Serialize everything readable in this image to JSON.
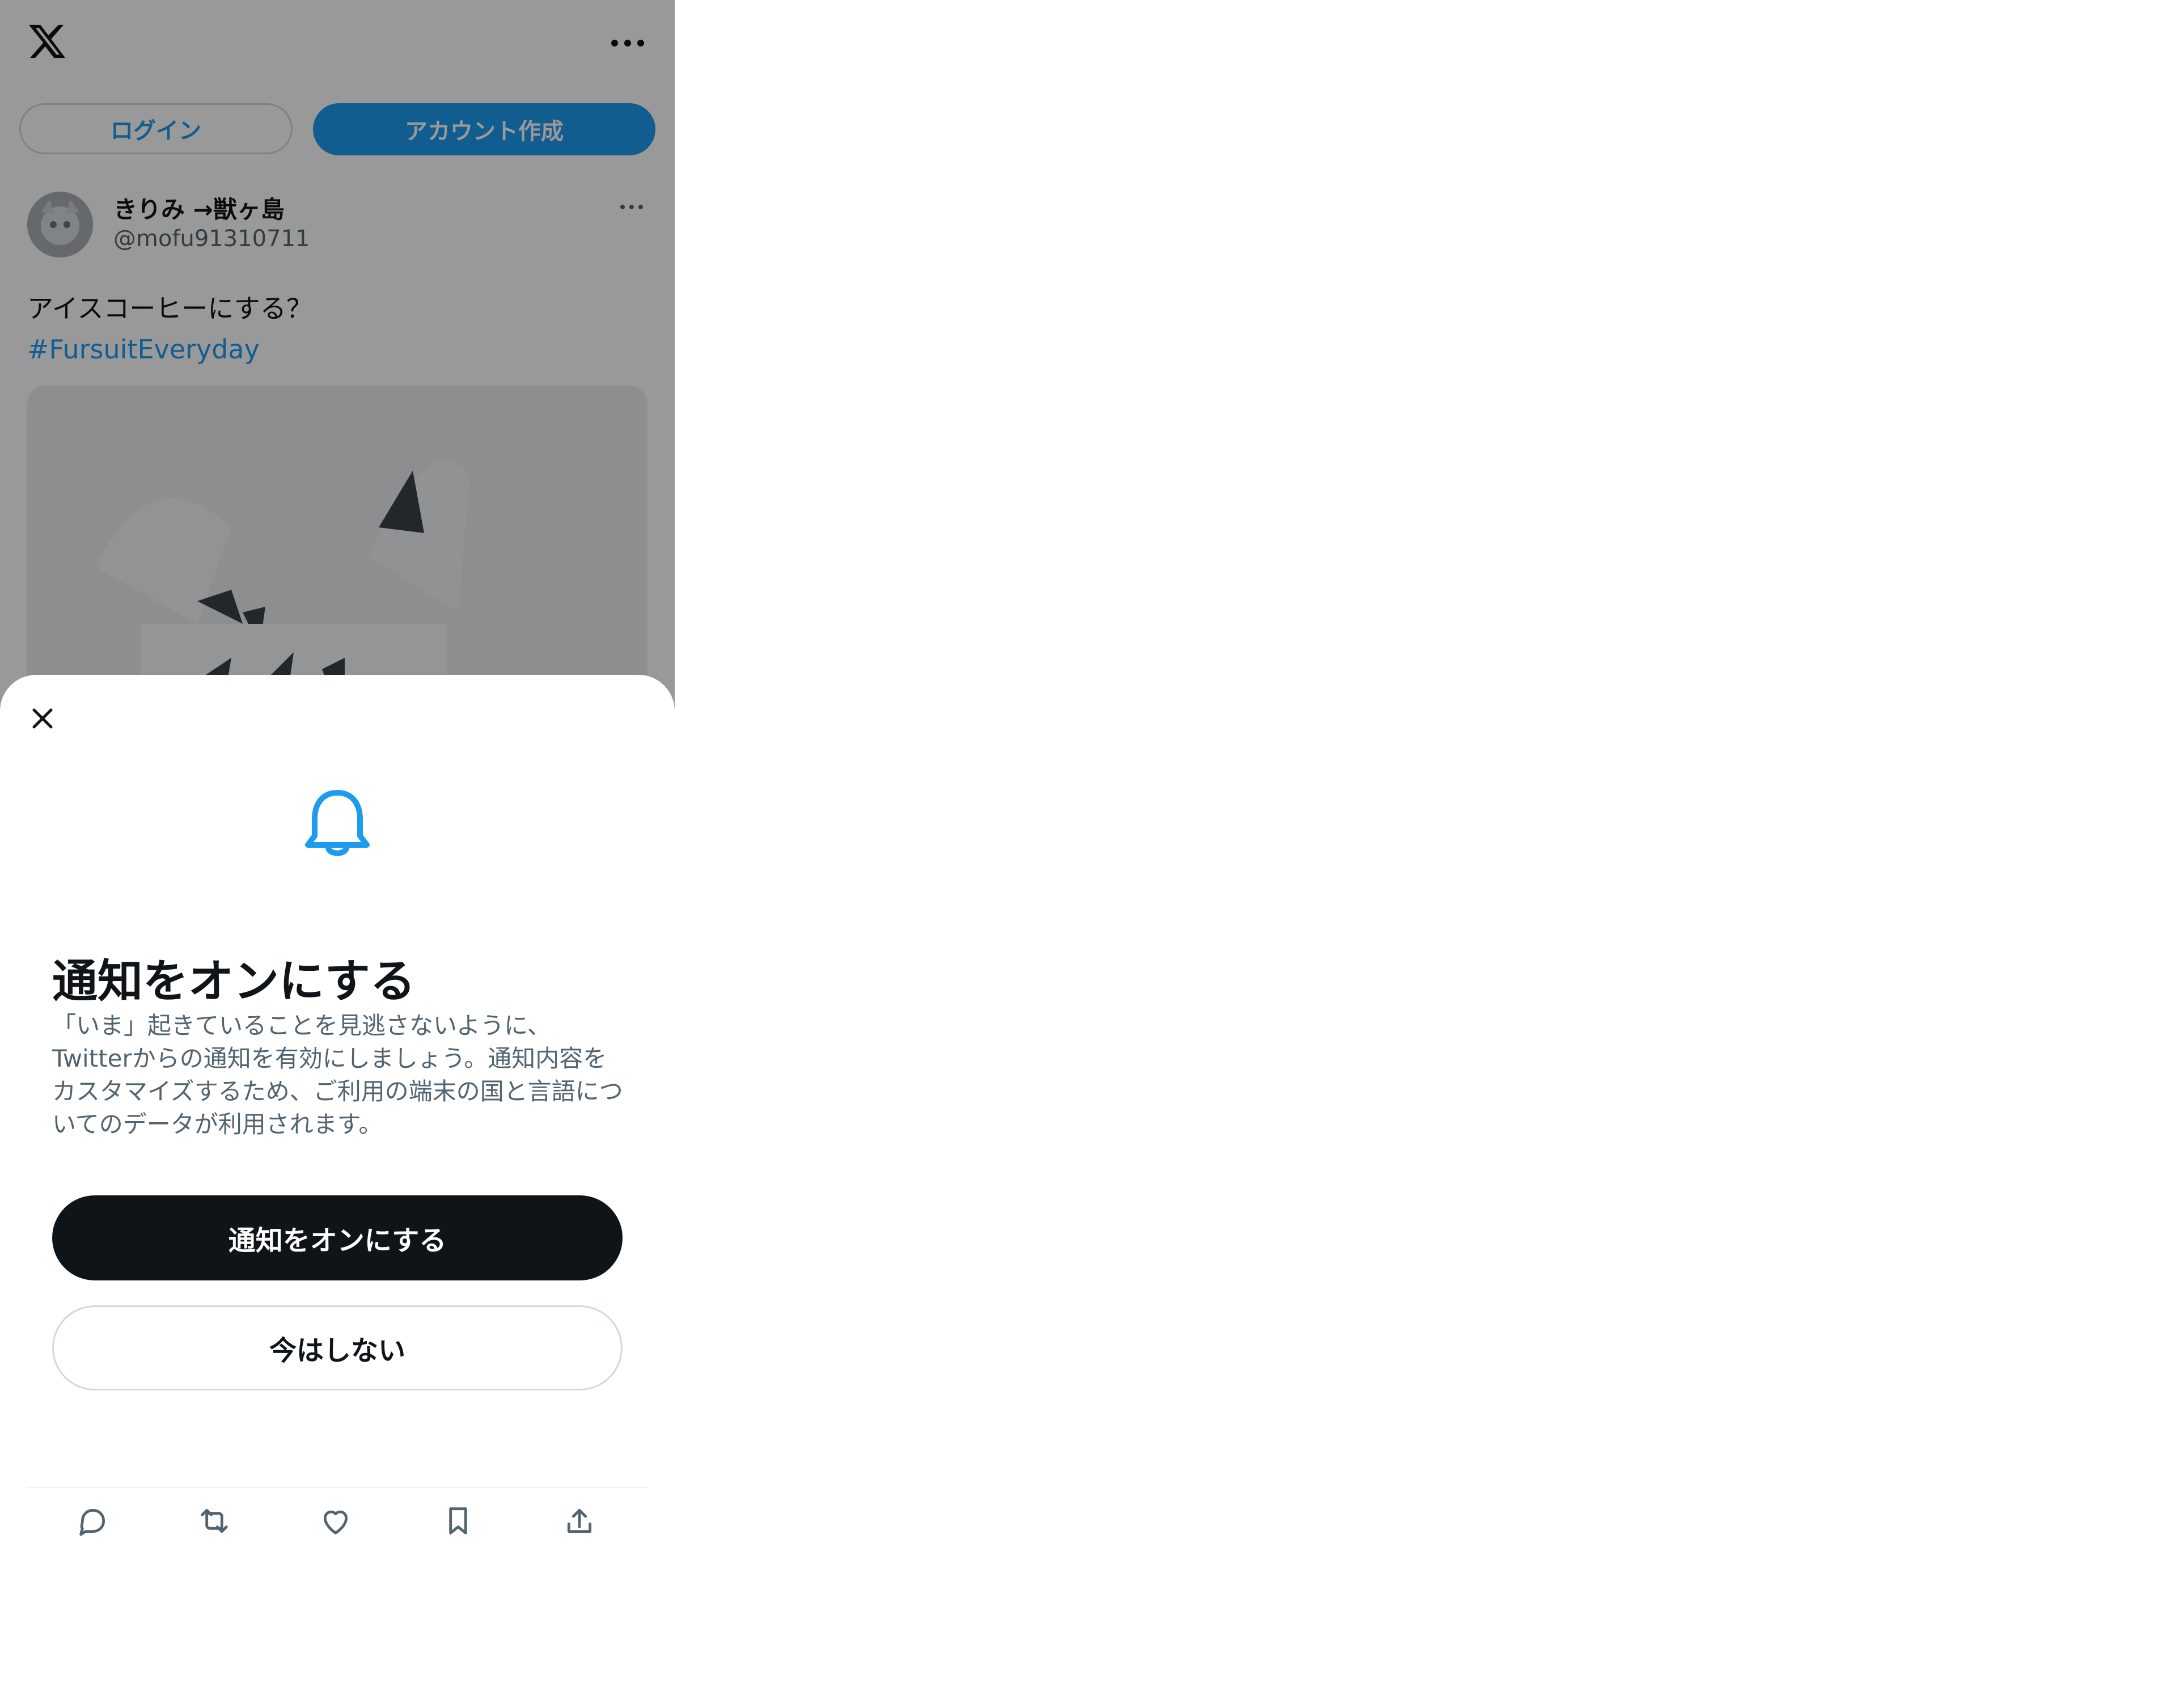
{
  "header": {
    "logo": "x-logo",
    "more": "more-icon"
  },
  "auth": {
    "login_label": "ログイン",
    "signup_label": "アカウント作成"
  },
  "post": {
    "display_name": "きりみ →獣ヶ島",
    "handle": "@mofu91310711",
    "text": "アイスコーヒーにする？",
    "hashtag": "#FursuitEveryday"
  },
  "sheet": {
    "title": "通知をオンにする",
    "body": "「いま」起きていることを見逃さないように、Twitterからの通知を有効にしましょう。通知内容をカスタマイズするため、ご利用の端末の国と言語についてのデータが利用されます。",
    "primary_label": "通知をオンにする",
    "secondary_label": "今はしない"
  },
  "actions": [
    "reply-icon",
    "retweet-icon",
    "like-icon",
    "bookmark-icon",
    "share-icon"
  ],
  "colors": {
    "accent": "#1d9bf0",
    "text": "#0f1419",
    "muted": "#536471"
  }
}
